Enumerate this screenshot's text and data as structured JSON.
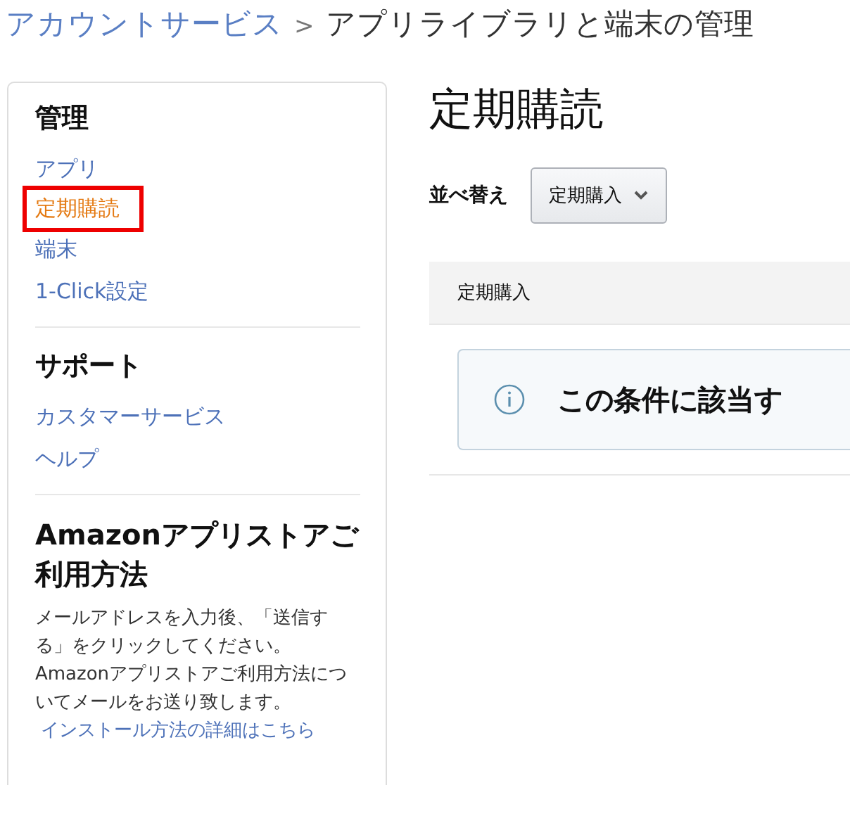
{
  "breadcrumb": {
    "parent": "アカウントサービス",
    "separator": ">",
    "current": "アプリライブラリと端末の管理"
  },
  "sidebar": {
    "sections": [
      {
        "heading": "管理",
        "items": [
          {
            "label": "アプリ",
            "selected": false
          },
          {
            "label": "定期購読",
            "selected": true
          },
          {
            "label": "端末",
            "selected": false
          },
          {
            "label": "1-Click設定",
            "selected": false
          }
        ]
      },
      {
        "heading": "サポート",
        "items": [
          {
            "label": "カスタマーサービス",
            "selected": false
          },
          {
            "label": "ヘルプ",
            "selected": false
          }
        ]
      }
    ],
    "info": {
      "heading": "Amazonアプリストアご利用方法",
      "text": "メールアドレスを入力後、「送信する」をクリックしてください。Amazonアプリストアご利用方法についてメールをお送り致します。",
      "link": "インストール方法の詳細はこちら"
    }
  },
  "main": {
    "title": "定期購読",
    "sort_label": "並べ替え",
    "sort_value": "定期購入",
    "table_header": "定期購入",
    "notice": "この条件に該当す"
  }
}
